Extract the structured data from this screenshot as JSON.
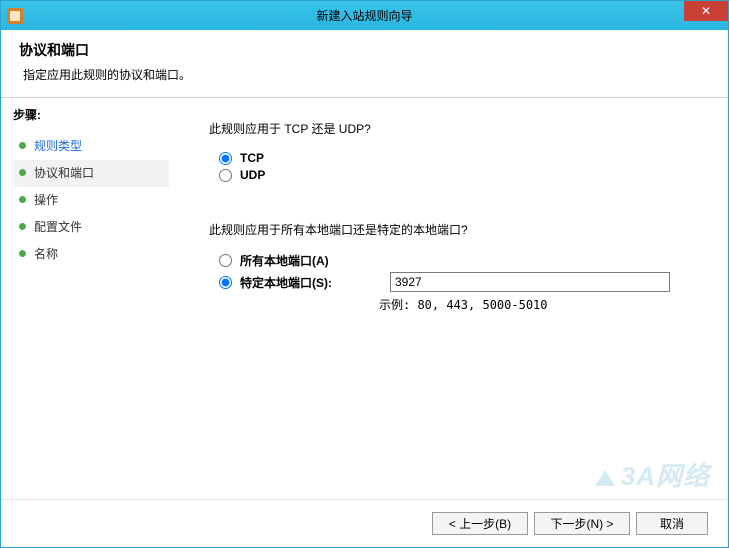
{
  "window": {
    "title": "新建入站规则向导",
    "close_label": "✕"
  },
  "header": {
    "title": "协议和端口",
    "subtitle": "指定应用此规则的协议和端口。"
  },
  "sidebar": {
    "steps_label": "步骤:",
    "items": [
      {
        "label": "规则类型"
      },
      {
        "label": "协议和端口"
      },
      {
        "label": "操作"
      },
      {
        "label": "配置文件"
      },
      {
        "label": "名称"
      }
    ]
  },
  "content": {
    "protocol_question": "此规则应用于 TCP 还是 UDP?",
    "tcp_label": "TCP",
    "udp_label": "UDP",
    "port_question": "此规则应用于所有本地端口还是特定的本地端口?",
    "all_ports_label": "所有本地端口(A)",
    "specific_ports_label": "特定本地端口(S):",
    "port_value": "3927",
    "example_label": "示例: 80, 443, 5000-5010"
  },
  "footer": {
    "back": "< 上一步(B)",
    "next": "下一步(N) >",
    "cancel": "取消"
  },
  "watermark": "3A网络"
}
